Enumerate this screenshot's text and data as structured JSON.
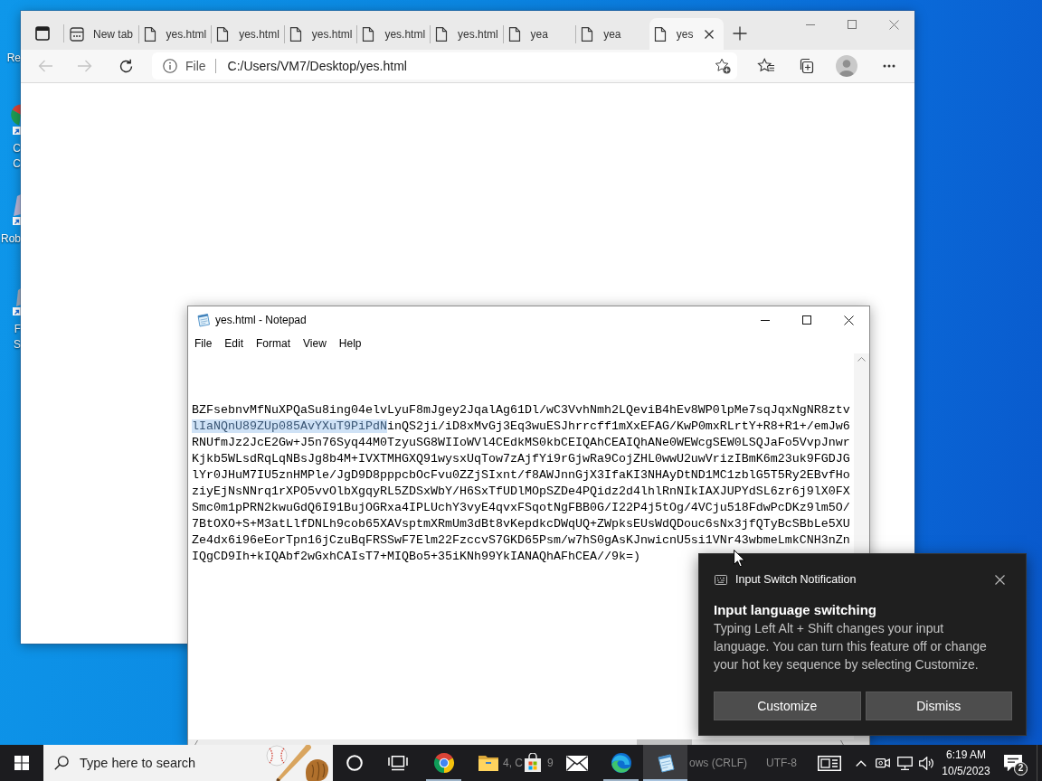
{
  "desktop_icons": [
    {
      "kind": "bin",
      "label_lines": [
        "Re"
      ]
    },
    {
      "kind": "chrome",
      "label_lines": [
        "C",
        "C"
      ]
    },
    {
      "kind": "robot",
      "label_lines": [
        "Rob"
      ]
    },
    {
      "kind": "app",
      "label_lines": [
        "F",
        "S"
      ]
    }
  ],
  "browser": {
    "tabs": [
      {
        "kind": "newtab",
        "label": "New tab",
        "selected": false
      },
      {
        "kind": "file",
        "label": "yes.html",
        "selected": false
      },
      {
        "kind": "file",
        "label": "yes.html",
        "selected": false
      },
      {
        "kind": "file",
        "label": "yes.html",
        "selected": false
      },
      {
        "kind": "file",
        "label": "yes.html",
        "selected": false
      },
      {
        "kind": "file",
        "label": "yes.html",
        "selected": false
      },
      {
        "kind": "file",
        "label": "yea",
        "selected": false
      },
      {
        "kind": "file",
        "label": "yea",
        "selected": false
      },
      {
        "kind": "file",
        "label": "yes",
        "selected": true
      }
    ],
    "toolbar": {
      "back": {
        "disabled": true
      },
      "forward": {
        "disabled": true
      }
    },
    "address_bar": {
      "scheme": "File",
      "url": "C:/Users/VM7/Desktop/yes.html"
    }
  },
  "notepad": {
    "title": "yes.html - Notepad",
    "menu": [
      "File",
      "Edit",
      "Format",
      "View",
      "Help"
    ],
    "lines": [
      {
        "segments": [
          {
            "text": "BZFsebnvMfNuXPQaSu8ing04elvLyuF8mJgey2JqalAg61Dl/wC3VvhNmh2LQeviB4hEv8WP0lpMe7sqJqxNgNR8ztv",
            "selected": false
          }
        ]
      },
      {
        "segments": [
          {
            "text": "lIaNQnU89ZUp085AvYXuT9PiPdN",
            "selected": true
          },
          {
            "text": "inQS2ji/iD8xMvGj3Eq3wuESJhrrcff1mXxEFAG/KwP0mxRLrtY+R8+R1+/emJw6",
            "selected": false
          }
        ]
      },
      {
        "segments": [
          {
            "text": "RNUfmJz2JcE2Gw+J5n76Syq44M0TzyuSG8WIIoWVl4CEdkMS0kbCEIQAhCEAIQhANe0WEWcgSEW0LSQJaFo5VvpJnwr",
            "selected": false
          }
        ]
      },
      {
        "segments": [
          {
            "text": "Kjkb5WLsdRqLqNBsJg8b4M+IVXTMHGXQ91wysxUqTow7zAjfYi9rGjwRa9CojZHL0wwU2uwVrizIBmK6m23uk9FGDJG",
            "selected": false
          }
        ]
      },
      {
        "segments": [
          {
            "text": "lYr0JHuM7IU5znHMPle/JgD9D8pppcbOcFvu0ZZjSIxnt/f8AWJnnGjX3IfaKI3NHAyDtND1MC1zblG5T5Ry2EBvfHo",
            "selected": false
          }
        ]
      },
      {
        "segments": [
          {
            "text": "ziyEjNsNNrq1rXPO5vvOlbXgqyRL5ZDSxWbY/H6SxTfUDlMOpSZDe4PQidz2d4lhlRnNIkIAXJUPYdSL6zr6j9lX0FX",
            "selected": false
          }
        ]
      },
      {
        "segments": [
          {
            "text": "Smc0m1pPRN2kwuGdQ6I91BujOGRxa4IPLUchY3vyE4qvxFSqotNgFBB0G/I22P4j5tOg/4VCju518FdwPcDKz9lm5O/",
            "selected": false
          }
        ]
      },
      {
        "segments": [
          {
            "text": "7BtOXO+S+M3atLlfDNLh9cob65XAVsptmXRmUm3dBt8vKepdkcDWqUQ+ZWpksEUsWdQDouc6sNx3jfQTyBcSBbLe5XU",
            "selected": false
          }
        ]
      },
      {
        "segments": [
          {
            "text": "Ze4dx6i96eEorTpn16jCzuBqFRSSwF7Elm22FzccvS7GKD65Psm/w7hS0gAsKJnwicnU5si1VNr43wbmeLmkCNH3nZn",
            "selected": false
          }
        ]
      },
      {
        "segments": [
          {
            "text": "IQgCD9Ih+kIQAbf2wGxhCAIsT7+MIQBo5+35iKNh99YkIANAQhAFhCEA//9k=)",
            "selected": false
          }
        ]
      }
    ],
    "status_bar": [
      "4, C",
      "9",
      "ows (CRLF)",
      "UTF-8"
    ]
  },
  "notification": {
    "app": "Input Switch Notification",
    "title": "Input language switching",
    "body": "Typing Left Alt + Shift changes your input language. You can turn this feature off or change your hot key sequence by selecting Customize.",
    "buttons": [
      "Customize",
      "Dismiss"
    ]
  },
  "taskbar": {
    "search": {
      "placeholder": "Type here to search"
    },
    "apps": [
      {
        "kind": "chrome",
        "running": true,
        "active": false
      },
      {
        "kind": "explorer",
        "running": false,
        "active": false
      },
      {
        "kind": "store",
        "running": false,
        "active": false
      },
      {
        "kind": "mail",
        "running": false,
        "active": false
      },
      {
        "kind": "edge",
        "running": true,
        "active": false
      },
      {
        "kind": "notepad",
        "running": true,
        "active": true
      }
    ],
    "clock": {
      "time": "6:19 AM",
      "date": "10/5/2023"
    },
    "notification_count": "2"
  }
}
